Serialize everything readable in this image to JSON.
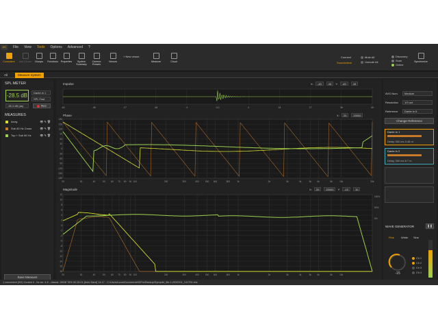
{
  "menu": {
    "logo": "AS",
    "items": [
      "File",
      "View",
      "Tools",
      "Options",
      "Advanced",
      "?"
    ],
    "active": "Tools"
  },
  "ribbon": {
    "buttons": [
      {
        "label": "Controllers",
        "state": "selected"
      },
      {
        "label": "Add Device",
        "state": "disabled"
      },
      {
        "label": "Groups",
        "state": "normal"
      },
      {
        "label": "Functions",
        "state": "normal"
      },
      {
        "label": "Properties",
        "state": "normal"
      },
      {
        "label": "System Summary",
        "state": "normal"
      },
      {
        "label": "Camera Presets",
        "state": "normal"
      },
      {
        "label": "Venues",
        "state": "normal"
      },
      {
        "label": "Measure",
        "state": "normal"
      },
      {
        "label": "Cloud",
        "state": "normal"
      }
    ],
    "new_venue": "New venue",
    "connect_label": "Connect",
    "soundcheck_label": "Soundcheck",
    "mute_all": "Mute All",
    "unmute_all": "Unmute All",
    "discovery": "Discovery",
    "scan": "Scan",
    "online": "Online",
    "synchronize": "Synchronize"
  },
  "tabs": [
    "All",
    "Measure System"
  ],
  "left": {
    "spl_title": "SPL METER",
    "spl_value": "-28.5 dB",
    "source": "Dante in 1",
    "weighting": "SPL Fast",
    "peak": "-35.3 dB (as)",
    "measures_title": "MEASURES",
    "measures": [
      {
        "name": "Array",
        "color": "#d7de2f"
      },
      {
        "name": "Sub 80 Hz Cross",
        "color": "#c77a2a"
      },
      {
        "name": "Top + Sub 80 Hz",
        "color": "#9bd24e"
      }
    ],
    "save_measure": "Save Measure",
    "rec_label": "Rec"
  },
  "impulse": {
    "label": "Impulse",
    "x_from": "-45",
    "x_to": "45",
    "y_from": "-45",
    "y_to": "45",
    "ticks": [
      "-45",
      "-36",
      "-27",
      "-18",
      "-9",
      "0.0",
      "9",
      "18",
      "27",
      "36",
      "45"
    ]
  },
  "phase": {
    "label": "Phase",
    "x_from": "20",
    "x_to": "20000",
    "yticks": [
      "180",
      "150",
      "120",
      "90",
      "60",
      "30",
      "0",
      "-30",
      "-60",
      "-90",
      "-120",
      "-150",
      "-180"
    ],
    "xticks": [
      "20",
      "30",
      "40",
      "50",
      "60",
      "70",
      "80",
      "90",
      "100",
      "200",
      "300",
      "400",
      "500",
      "600",
      "800",
      "1k",
      "2k",
      "3k",
      "4k",
      "5k",
      "6k",
      "8k",
      "10k",
      "20k"
    ]
  },
  "magnitude": {
    "label": "Magnitude",
    "x_from": "20",
    "x_to": "20000",
    "y_from": "-10",
    "y_to": "10",
    "yticks": [
      "12",
      "10",
      "8",
      "6",
      "4",
      "2",
      "0",
      "-2",
      "-4",
      "-6",
      "-8",
      "-10",
      "-12",
      "-14",
      "-16",
      "-18"
    ],
    "rticks": [
      "100%",
      "50%",
      "0%"
    ],
    "xticks": [
      "20",
      "30",
      "40",
      "50",
      "60",
      "70",
      "80",
      "90",
      "100",
      "200",
      "300",
      "400",
      "500",
      "600",
      "800",
      "1k",
      "2k",
      "3k",
      "4k",
      "5k",
      "6k",
      "8k",
      "10k"
    ]
  },
  "right": {
    "avg_label": "AVG Num.",
    "avg_value": "Medium",
    "res_label": "Resolution",
    "res_value": "1/3 oct",
    "ref_label": "Reference",
    "ref_value": "Dante in 5",
    "change_ref": "Change Reference",
    "cards": [
      {
        "title": "Dante in 1",
        "delay": "Delay 350",
        "extra": "ms 3.48 m"
      },
      {
        "title": "Dante in 2",
        "delay": "Delay 350",
        "extra": "ms 8.7 m"
      }
    ],
    "wave_title": "WAVE GENERATOR",
    "wave_types": [
      "Pink",
      "White",
      "Sine"
    ],
    "gain": "-15",
    "channels": [
      "Ch 1",
      "Ch 2",
      "Ch 3",
      "Ch 4"
    ]
  },
  "status": "1 connected (0/0) Control 0 - fw ver. 4.5 - classic: 28/28 76% 02:15:01 [Auto Save] 14:17 - C:\\Users\\Luca\\Documents\\DiPro\\Backup\\Synoptic_file-1-2020101_141751.vbe",
  "colors": {
    "accent": "#f0a000",
    "green": "#9bd24e",
    "yellow": "#d7de2f",
    "brown": "#c77a2a",
    "dark": "#1e1e1e"
  },
  "chart_data": [
    {
      "type": "line",
      "title": "Impulse",
      "xlim": [
        -45,
        45
      ],
      "series": []
    },
    {
      "type": "line",
      "title": "Phase",
      "xlim": [
        20,
        20000
      ],
      "ylim": [
        -180,
        180
      ],
      "series": []
    },
    {
      "type": "line",
      "title": "Magnitude",
      "xlim": [
        20,
        20000
      ],
      "ylim": [
        -18,
        12
      ],
      "series": []
    }
  ]
}
